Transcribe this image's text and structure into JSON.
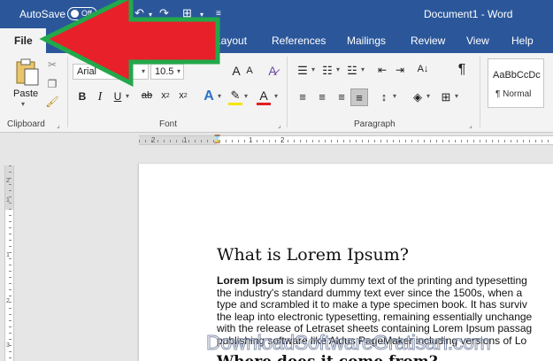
{
  "titlebar": {
    "autosave_label": "AutoSave",
    "autosave_state": "Off",
    "document_title": "Document1  -  Word"
  },
  "tabs": {
    "file": "File",
    "layout": "Layout",
    "references": "References",
    "mailings": "Mailings",
    "review": "Review",
    "view": "View",
    "help": "Help"
  },
  "ribbon": {
    "clipboard": {
      "paste_label": "Paste",
      "group_label": "Clipboard"
    },
    "font": {
      "font_name": "Arial",
      "font_size": "10.5",
      "group_label": "Font",
      "grow": "A",
      "shrink": "A"
    },
    "paragraph": {
      "group_label": "Paragraph",
      "show_marks": "¶"
    },
    "styles": {
      "sample": "AaBbCcDc",
      "name": "¶ Normal"
    }
  },
  "ruler": {
    "h_numbers": [
      "2",
      "1",
      "1",
      "2"
    ],
    "v_numbers": [
      "2",
      "1",
      "1",
      "2",
      "3"
    ]
  },
  "document": {
    "heading": "What is Lorem Ipsum?",
    "bold_lead": "Lorem Ipsum",
    "lines": [
      " is simply dummy text of the printing and typesetting",
      "the industry's standard dummy text ever since the 1500s, when a",
      "type and scrambled it to make a type specimen book. It has surviv",
      "the leap into electronic typesetting, remaining essentially unchange",
      "with the release of Letraset sheets containing Lorem Ipsum passag",
      "publishing software like Aldus PageMaker including versions of Lo"
    ],
    "heading2": "Where does it come from?"
  },
  "watermark": "DownloadSoftwareGratisan.com",
  "colors": {
    "word_blue": "#2b579a",
    "arrow_red": "#e8202a",
    "arrow_green": "#22a84a"
  }
}
